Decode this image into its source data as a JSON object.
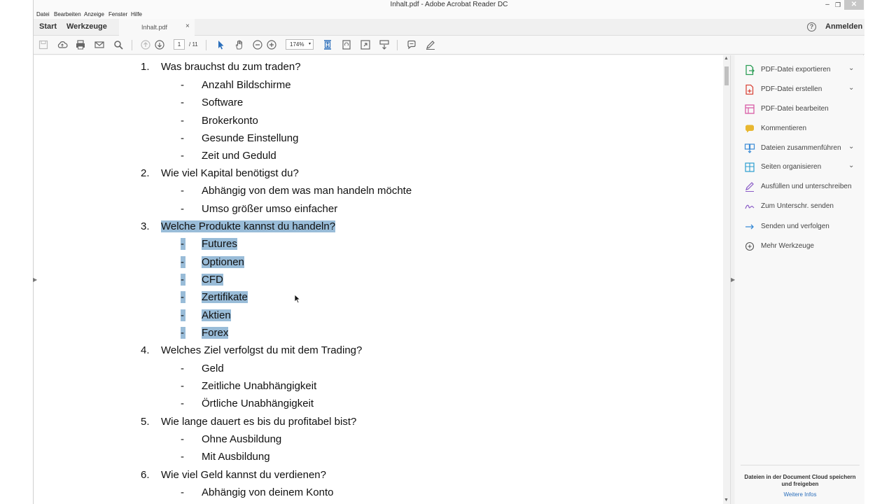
{
  "window": {
    "title": "Inhalt.pdf - Adobe Acrobat Reader DC",
    "minimize": "–",
    "restore": "❐",
    "close": "✕"
  },
  "menu": [
    "Datei",
    "Bearbeiten",
    "Anzeige",
    "Fenster",
    "Hilfe"
  ],
  "tabs": {
    "start": "Start",
    "tools": "Werkzeuge",
    "document": "Inhalt.pdf",
    "close": "×",
    "help": "?",
    "signin": "Anmelden"
  },
  "toolbar": {
    "page_current": "1",
    "page_total": "/ 11",
    "zoom": "174%",
    "zoom_dropdown": "▾"
  },
  "document": {
    "items": [
      {
        "number": "1.",
        "text": "Was brauchst du zum traden?",
        "highlighted": false,
        "subitems": [
          {
            "text": "Anzahl Bildschirme",
            "highlighted": false
          },
          {
            "text": "Software",
            "highlighted": false
          },
          {
            "text": "Brokerkonto",
            "highlighted": false
          },
          {
            "text": "Gesunde Einstellung",
            "highlighted": false
          },
          {
            "text": "Zeit und Geduld",
            "highlighted": false
          }
        ]
      },
      {
        "number": "2.",
        "text": "Wie viel Kapital benötigst du?",
        "highlighted": false,
        "subitems": [
          {
            "text": "Abhängig von dem was man handeln möchte",
            "highlighted": false
          },
          {
            "text": "Umso größer umso einfacher",
            "highlighted": false
          }
        ]
      },
      {
        "number": "3.",
        "text": "Welche Produkte kannst du handeln?",
        "highlighted": true,
        "subitems": [
          {
            "text": "Futures",
            "highlighted": true
          },
          {
            "text": "Optionen",
            "highlighted": true
          },
          {
            "text": "CFD",
            "highlighted": true
          },
          {
            "text": "Zertifikate",
            "highlighted": true
          },
          {
            "text": "Aktien",
            "highlighted": true
          },
          {
            "text": "Forex",
            "highlighted": true
          }
        ]
      },
      {
        "number": "4.",
        "text": "Welches Ziel verfolgst du mit dem Trading?",
        "highlighted": false,
        "subitems": [
          {
            "text": "Geld",
            "highlighted": false
          },
          {
            "text": "Zeitliche Unabhängigkeit",
            "highlighted": false
          },
          {
            "text": "Örtliche Unabhängigkeit",
            "highlighted": false
          }
        ]
      },
      {
        "number": "5.",
        "text": "Wie lange dauert es bis du profitabel bist?",
        "highlighted": false,
        "subitems": [
          {
            "text": "Ohne Ausbildung",
            "highlighted": false
          },
          {
            "text": "Mit Ausbildung",
            "highlighted": false
          }
        ]
      },
      {
        "number": "6.",
        "text": "Wie viel Geld kannst du verdienen?",
        "highlighted": false,
        "subitems": [
          {
            "text": "Abhängig von deinem Konto",
            "highlighted": false
          }
        ]
      }
    ],
    "dash": "-"
  },
  "right_pane": {
    "tools": [
      {
        "label": "PDF-Datei exportieren",
        "icon": "export-pdf-icon",
        "color": "#2e9e57",
        "expandable": true
      },
      {
        "label": "PDF-Datei erstellen",
        "icon": "create-pdf-icon",
        "color": "#d9473b",
        "expandable": true
      },
      {
        "label": "PDF-Datei bearbeiten",
        "icon": "edit-pdf-icon",
        "color": "#d85ca6",
        "expandable": false
      },
      {
        "label": "Kommentieren",
        "icon": "comment-icon",
        "color": "#e8b730",
        "expandable": false
      },
      {
        "label": "Dateien zusammenführen",
        "icon": "combine-files-icon",
        "color": "#3a8bd6",
        "expandable": true
      },
      {
        "label": "Seiten organisieren",
        "icon": "organize-pages-icon",
        "color": "#2c9ed0",
        "expandable": true
      },
      {
        "label": "Ausfüllen und unterschreiben",
        "icon": "fill-sign-icon",
        "color": "#8a5bc7",
        "expandable": false
      },
      {
        "label": "Zum Unterschr. senden",
        "icon": "send-signature-icon",
        "color": "#8a5bc7",
        "expandable": false
      },
      {
        "label": "Senden und verfolgen",
        "icon": "send-track-icon",
        "color": "#3a8bd6",
        "expandable": false
      },
      {
        "label": "Mehr Werkzeuge",
        "icon": "more-tools-icon",
        "color": "#555555",
        "expandable": false
      }
    ],
    "chevron": "⌄",
    "cloud_text": "Dateien in der Document Cloud speichern und freigeben",
    "more_info": "Weitere Infos"
  },
  "colors": {
    "selection": "#99bcd8",
    "link": "#2a6ebb",
    "active_tool": "#2a6ebb"
  }
}
